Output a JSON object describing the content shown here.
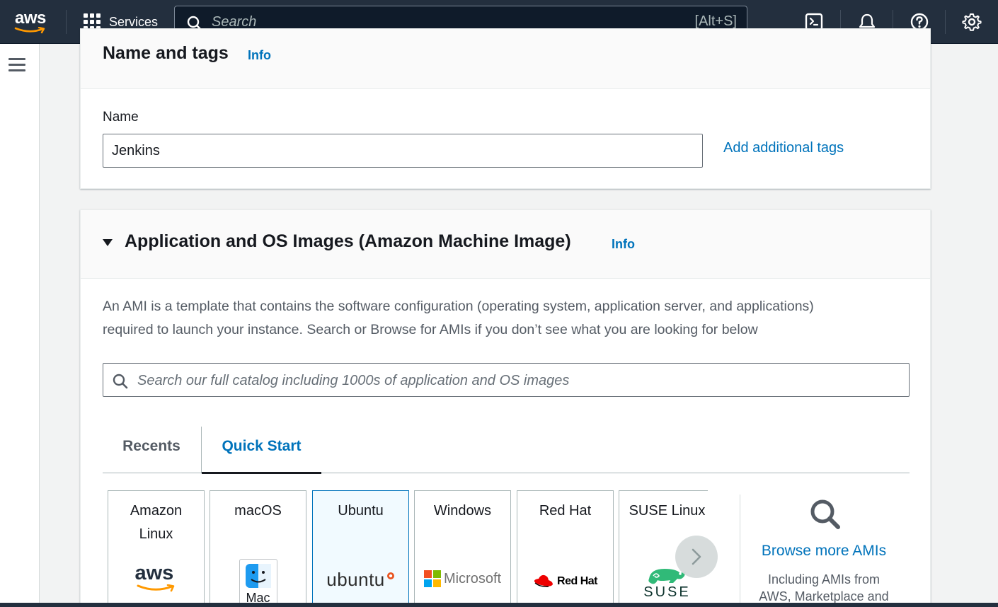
{
  "topnav": {
    "logo_text": "aws",
    "services_label": "Services",
    "search_placeholder": "Search",
    "search_shortcut": "[Alt+S]",
    "icons": [
      "cloudshell-icon",
      "bell-icon",
      "help-icon",
      "settings-icon"
    ]
  },
  "name_tags": {
    "title": "Name and tags",
    "info": "Info",
    "name_label": "Name",
    "name_value": "Jenkins",
    "add_tags": "Add additional tags"
  },
  "ami": {
    "title": "Application and OS Images (Amazon Machine Image)",
    "info": "Info",
    "description_line1": "An AMI is a template that contains the software configuration (operating system, application server, and applications)",
    "description_line2": "required to launch your instance. Search or Browse for AMIs if you don’t see what you are looking for below",
    "search_placeholder": "Search our full catalog including 1000s of application and OS images",
    "tabs": {
      "recents": "Recents",
      "quick_start": "Quick Start"
    },
    "tiles": [
      {
        "line1": "Amazon",
        "line2": "Linux",
        "logo": "aws"
      },
      {
        "line1": "macOS",
        "line2": "",
        "logo": "Mac"
      },
      {
        "line1": "Ubuntu",
        "line2": "",
        "logo": "ubuntu"
      },
      {
        "line1": "Windows",
        "line2": "",
        "logo": "Microsoft"
      },
      {
        "line1": "Red Hat",
        "line2": "",
        "logo": "Red Hat"
      },
      {
        "line1": "SUSE Linux",
        "line2": "",
        "logo": "SUSE"
      }
    ],
    "browse_title": "Browse more AMIs",
    "browse_sub_line1": "Including AMIs from",
    "browse_sub_line2": "AWS, Marketplace and"
  },
  "colors": {
    "nav": "#232f3e",
    "link": "#0073bb",
    "selected_bg": "#f1faff"
  }
}
